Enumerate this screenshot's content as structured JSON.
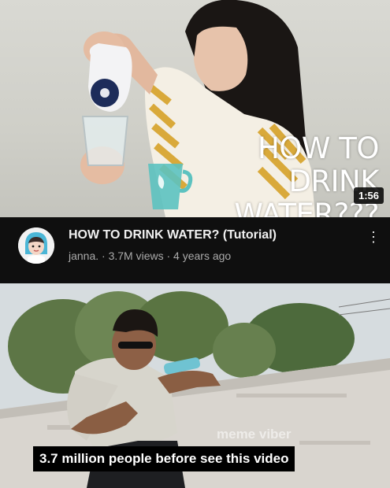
{
  "thumbnail": {
    "overlay_title": "HOW TO DRINK\nWATER???",
    "duration": "1:56"
  },
  "video": {
    "title": "HOW TO DRINK WATER? (Tutorial)",
    "meta": "janna. · 3.7M views · 4 years ago",
    "menu_icon": "more-vert-icon"
  },
  "meme": {
    "watermark": "meme viber",
    "caption": "3.7 million people before see this video"
  },
  "colors": {
    "app_background": "#0f0f0f",
    "title_text": "#f1f1f1",
    "meta_text": "#aaaaaa",
    "caption_background": "#000000"
  }
}
